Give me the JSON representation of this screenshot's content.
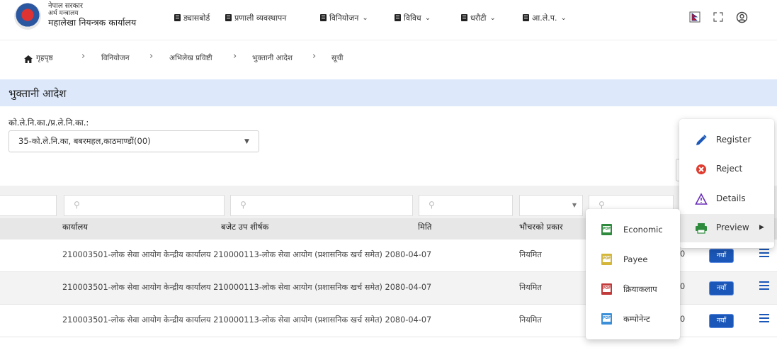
{
  "header": {
    "org_line1": "नेपाल सरकार",
    "org_line2": "अर्थ मन्त्रालय",
    "org_line3": "महालेखा नियन्त्रक कार्यालय",
    "nav": [
      {
        "label": "ड्यासबोर्ड",
        "dropdown": false
      },
      {
        "label": "प्रणाली व्यवस्थापन",
        "dropdown": false
      },
      {
        "label": "विनियोजन",
        "dropdown": true
      },
      {
        "label": "विविध",
        "dropdown": true
      },
      {
        "label": "धरौटी",
        "dropdown": true
      },
      {
        "label": "आ.ले.प.",
        "dropdown": true
      }
    ],
    "icons": [
      "language-flag-icon",
      "fullscreen-icon",
      "user-account-icon"
    ]
  },
  "breadcrumb": {
    "home": "गृहपृष्ठ",
    "items": [
      "विनियोजन",
      "अभिलेख प्रविष्टी",
      "भुक्तानी आदेश",
      "सूची"
    ]
  },
  "page": {
    "title": "भुक्तानी आदेश"
  },
  "filter": {
    "label": "को.ले.नि.का./प्र.ले.नि.का.:",
    "selected": "35-को.ले.नि.का, बबरमहल,काठमाण्डौं(00)"
  },
  "table": {
    "headers": [
      "कार्यालय",
      "बजेट उप शीर्षक",
      "मिति",
      "भौचरको प्रकार"
    ],
    "rows": [
      {
        "text": "210003501-लोक सेवा आयोग केन्द्रीय कार्यालय 210000113-लोक सेवा आयोग (प्रशासनिक खर्च समेत) 2080-04-07",
        "type": "नियमित",
        "partial": "0",
        "status": "नयाँ"
      },
      {
        "text": "210003501-लोक सेवा आयोग केन्द्रीय कार्यालय 210000113-लोक सेवा आयोग (प्रशासनिक खर्च समेत) 2080-04-07",
        "type": "नियमित",
        "partial": "0",
        "status": "नयाँ"
      },
      {
        "text": "210003501-लोक सेवा आयोग केन्द्रीय कार्यालय 210000113-लोक सेवा आयोग (प्रशासनिक खर्च समेत) 2080-04-07",
        "type": "नियमित",
        "partial": "0",
        "status": "नयाँ"
      }
    ]
  },
  "context_menu": {
    "items": [
      {
        "label": "Register",
        "icon": "pencil-icon"
      },
      {
        "label": "Reject",
        "icon": "reject-icon"
      },
      {
        "label": "Details",
        "icon": "warning-triangle-icon"
      },
      {
        "label": "Preview",
        "icon": "printer-icon"
      }
    ]
  },
  "preview_submenu": {
    "items": [
      {
        "label": "Economic",
        "color": "#2e8b3e"
      },
      {
        "label": "Payee",
        "color": "#d4b73a"
      },
      {
        "label": "क्रियाकलाप",
        "color": "#c23b3b"
      },
      {
        "label": "कम्पोनेन्ट",
        "color": "#3a8fd8"
      }
    ]
  },
  "colors": {
    "accent": "#1a57b8",
    "title_band": "#dde9fb"
  }
}
